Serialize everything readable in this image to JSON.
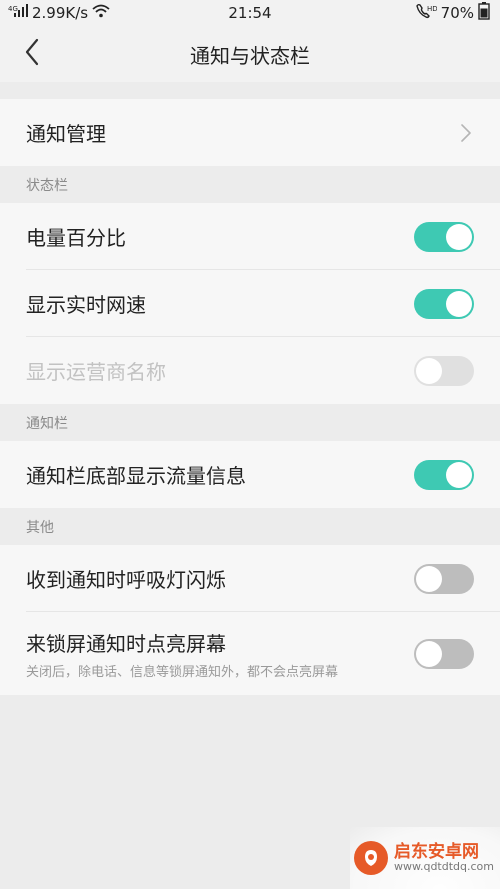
{
  "status_bar": {
    "network_speed": "2.99K/s",
    "time": "21:54",
    "battery": "70%"
  },
  "header": {
    "title": "通知与状态栏"
  },
  "rows": {
    "notification_manage": "通知管理",
    "battery_percent": "电量百分比",
    "realtime_speed": "显示实时网速",
    "carrier_name": "显示运营商名称",
    "traffic_info": "通知栏底部显示流量信息",
    "breathing_light": "收到通知时呼吸灯闪烁",
    "lockscreen_wake": "来锁屏通知时点亮屏幕",
    "lockscreen_wake_desc": "关闭后，除电话、信息等锁屏通知外，都不会点亮屏幕"
  },
  "sections": {
    "status_bar": "状态栏",
    "notification_bar": "通知栏",
    "other": "其他"
  },
  "toggles": {
    "battery_percent": "on",
    "realtime_speed": "on",
    "carrier_name": "off-disabled",
    "traffic_info": "on",
    "breathing_light": "off",
    "lockscreen_wake": "off"
  },
  "colors": {
    "accent": "#3ec9b3",
    "toggle_off": "#bdbdbd",
    "background": "#ececec",
    "row_background": "#f7f7f7",
    "watermark": "#e65a28"
  },
  "icons": {
    "signal": "signal-icon",
    "wifi": "wifi-icon",
    "hd_call": "hd-call-icon",
    "battery": "battery-icon",
    "back": "back-arrow-icon",
    "chevron": "chevron-right-icon"
  },
  "watermark": {
    "name": "启东安卓网",
    "url": "www.qdtdtdq.com"
  }
}
